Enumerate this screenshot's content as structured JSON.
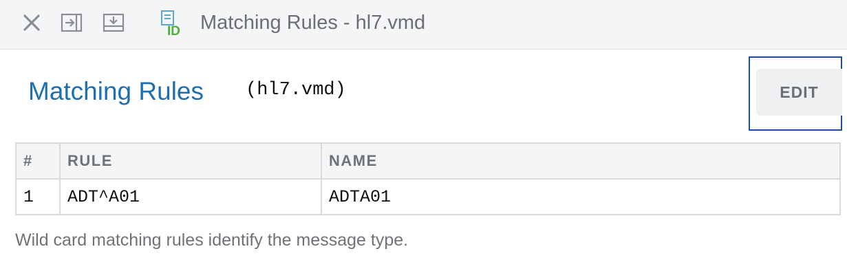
{
  "toolbar": {
    "icons": [
      "close-icon",
      "collapse-panel-icon",
      "download-icon",
      "document-id-icon"
    ],
    "title": "Matching Rules - hl7.vmd"
  },
  "header": {
    "title": "Matching Rules",
    "file": "(hl7.vmd)",
    "edit_label": "EDIT"
  },
  "table": {
    "columns": [
      "#",
      "RULE",
      "NAME"
    ],
    "rows": [
      [
        "1",
        "ADT^A01",
        "ADTA01"
      ]
    ]
  },
  "footer_note": "Wild card matching rules identify the message type.",
  "colors": {
    "accent": "#1f6fb0",
    "id_icon_green": "#4caf3a",
    "focus_border": "#1a4f97"
  }
}
